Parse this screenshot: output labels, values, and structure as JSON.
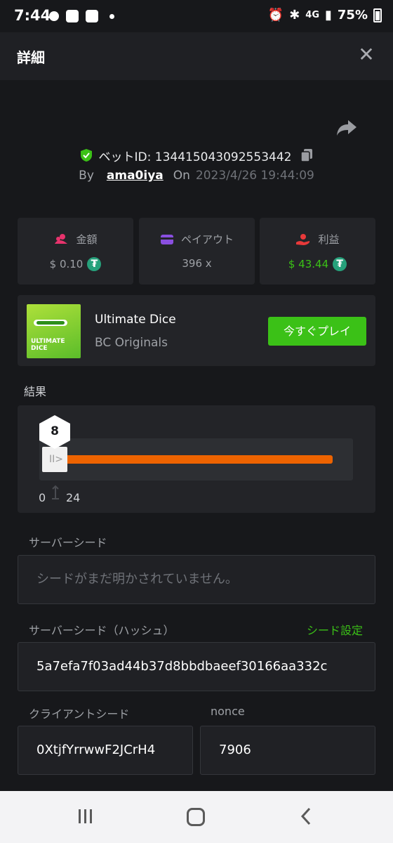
{
  "status_bar": {
    "time": "7:44",
    "network": "4G",
    "battery": "75%"
  },
  "header": {
    "title": "詳細",
    "close_icon": "close-icon"
  },
  "bet": {
    "id_label": "ベットID: 134415043092553442",
    "by_label": "By",
    "user": "ama0iya",
    "on_label": "On",
    "date": "2023/4/26 19:44:09"
  },
  "stats": [
    {
      "label": "金額",
      "value": "$ 0.10",
      "icon": "coins-icon",
      "color": "#e8336d"
    },
    {
      "label": "ペイアウト",
      "value": "396 x",
      "icon": "wallet-icon",
      "color": "#8a4fe0"
    },
    {
      "label": "利益",
      "value": "$ 43.44",
      "icon": "profit-icon",
      "color": "#e8393a"
    }
  ],
  "game": {
    "name": "Ultimate Dice",
    "provider": "BC Originals",
    "play_label": "今すぐプレイ",
    "thumb_text": "ULTIMATE DICE"
  },
  "result": {
    "label": "結果",
    "number": "8",
    "range_min": "0",
    "range_max": "24",
    "fill_fraction": 0.94
  },
  "seeds": {
    "server_seed_label": "サーバーシード",
    "server_seed_placeholder": "シードがまだ明かされていません。",
    "server_hash_label": "サーバーシード（ハッシュ）",
    "seed_settings_label": "シード設定",
    "server_hash_value": "5a7efa7f03ad44b37d8bbdbaeef30166aa332c",
    "client_seed_label": "クライアントシード",
    "client_seed_value": "0XtjfYrrwwF2JCrH4",
    "nonce_label": "nonce",
    "nonce_value": "7906"
  },
  "colors": {
    "accent_green": "#3bc117",
    "fill_orange": "#ed6300",
    "tether": "#26a17b"
  }
}
